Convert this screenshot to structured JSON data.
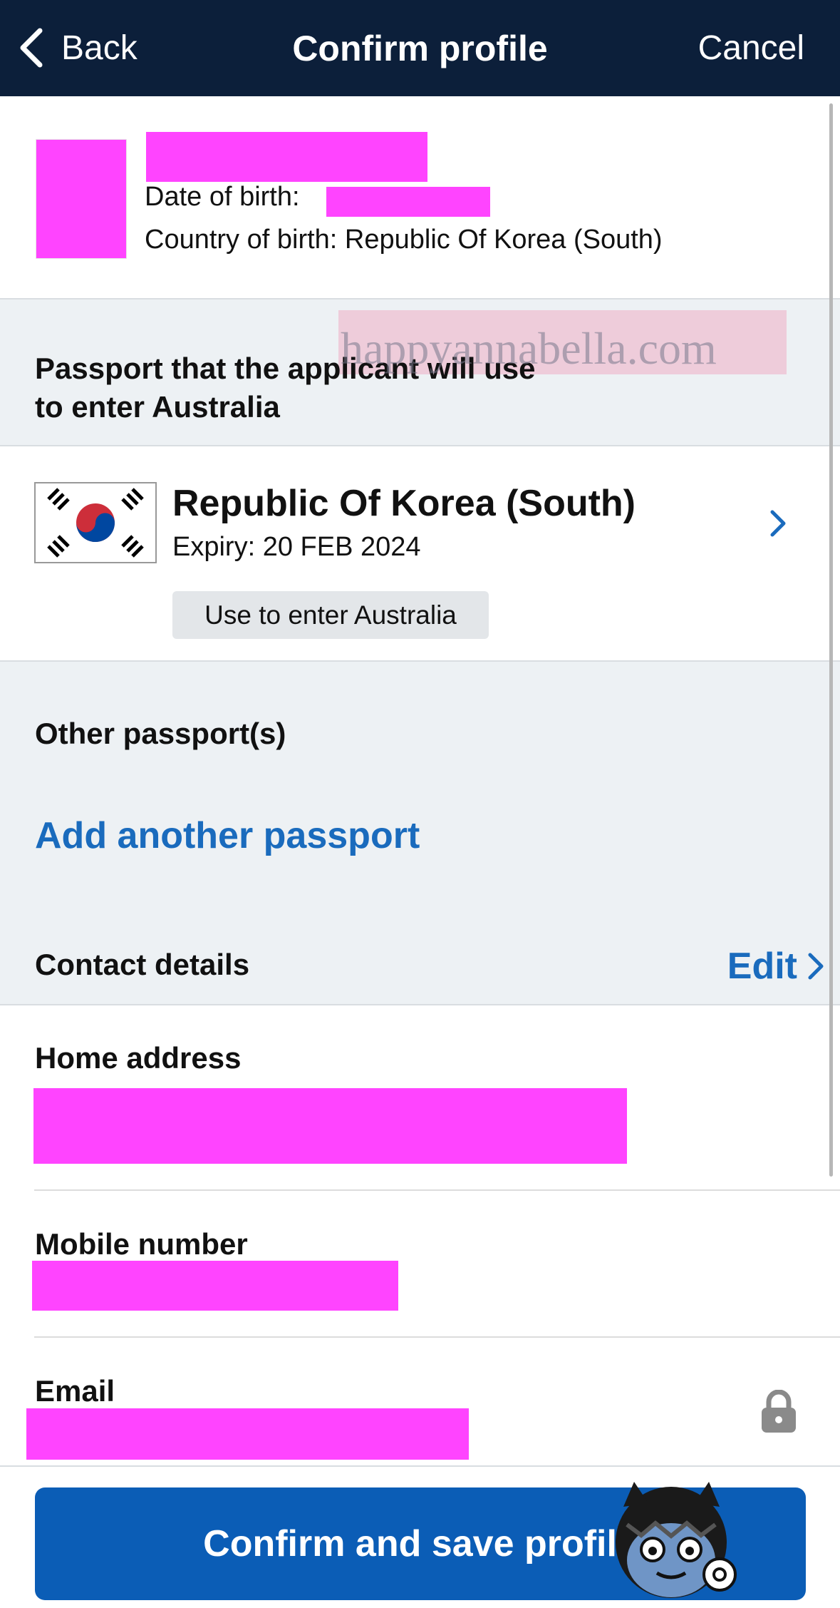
{
  "nav": {
    "back_label": "Back",
    "title": "Confirm profile",
    "cancel_label": "Cancel"
  },
  "profile": {
    "dob_label": "Date of birth:",
    "country_of_birth": "Country of birth: Republic Of Korea (South)"
  },
  "watermark": "happyannabella.com",
  "passport_section": {
    "heading_line1": "Passport that the applicant will use",
    "heading_line2": "to enter Australia",
    "country": "Republic Of Korea (South)",
    "expiry": "Expiry: 20 FEB 2024",
    "badge": "Use to enter Australia"
  },
  "other_passports": {
    "heading": "Other passport(s)",
    "add_link": "Add another passport"
  },
  "contact": {
    "heading": "Contact details",
    "edit_label": "Edit",
    "home_address_label": "Home address",
    "mobile_label": "Mobile number",
    "email_label": "Email"
  },
  "footer": {
    "confirm_label": "Confirm and save profile"
  },
  "colors": {
    "nav_bg": "#0c1f3a",
    "accent": "#1a6bbd",
    "button_bg": "#0b5db6",
    "section_bg": "#edf1f4",
    "redaction": "#ff44ff"
  }
}
